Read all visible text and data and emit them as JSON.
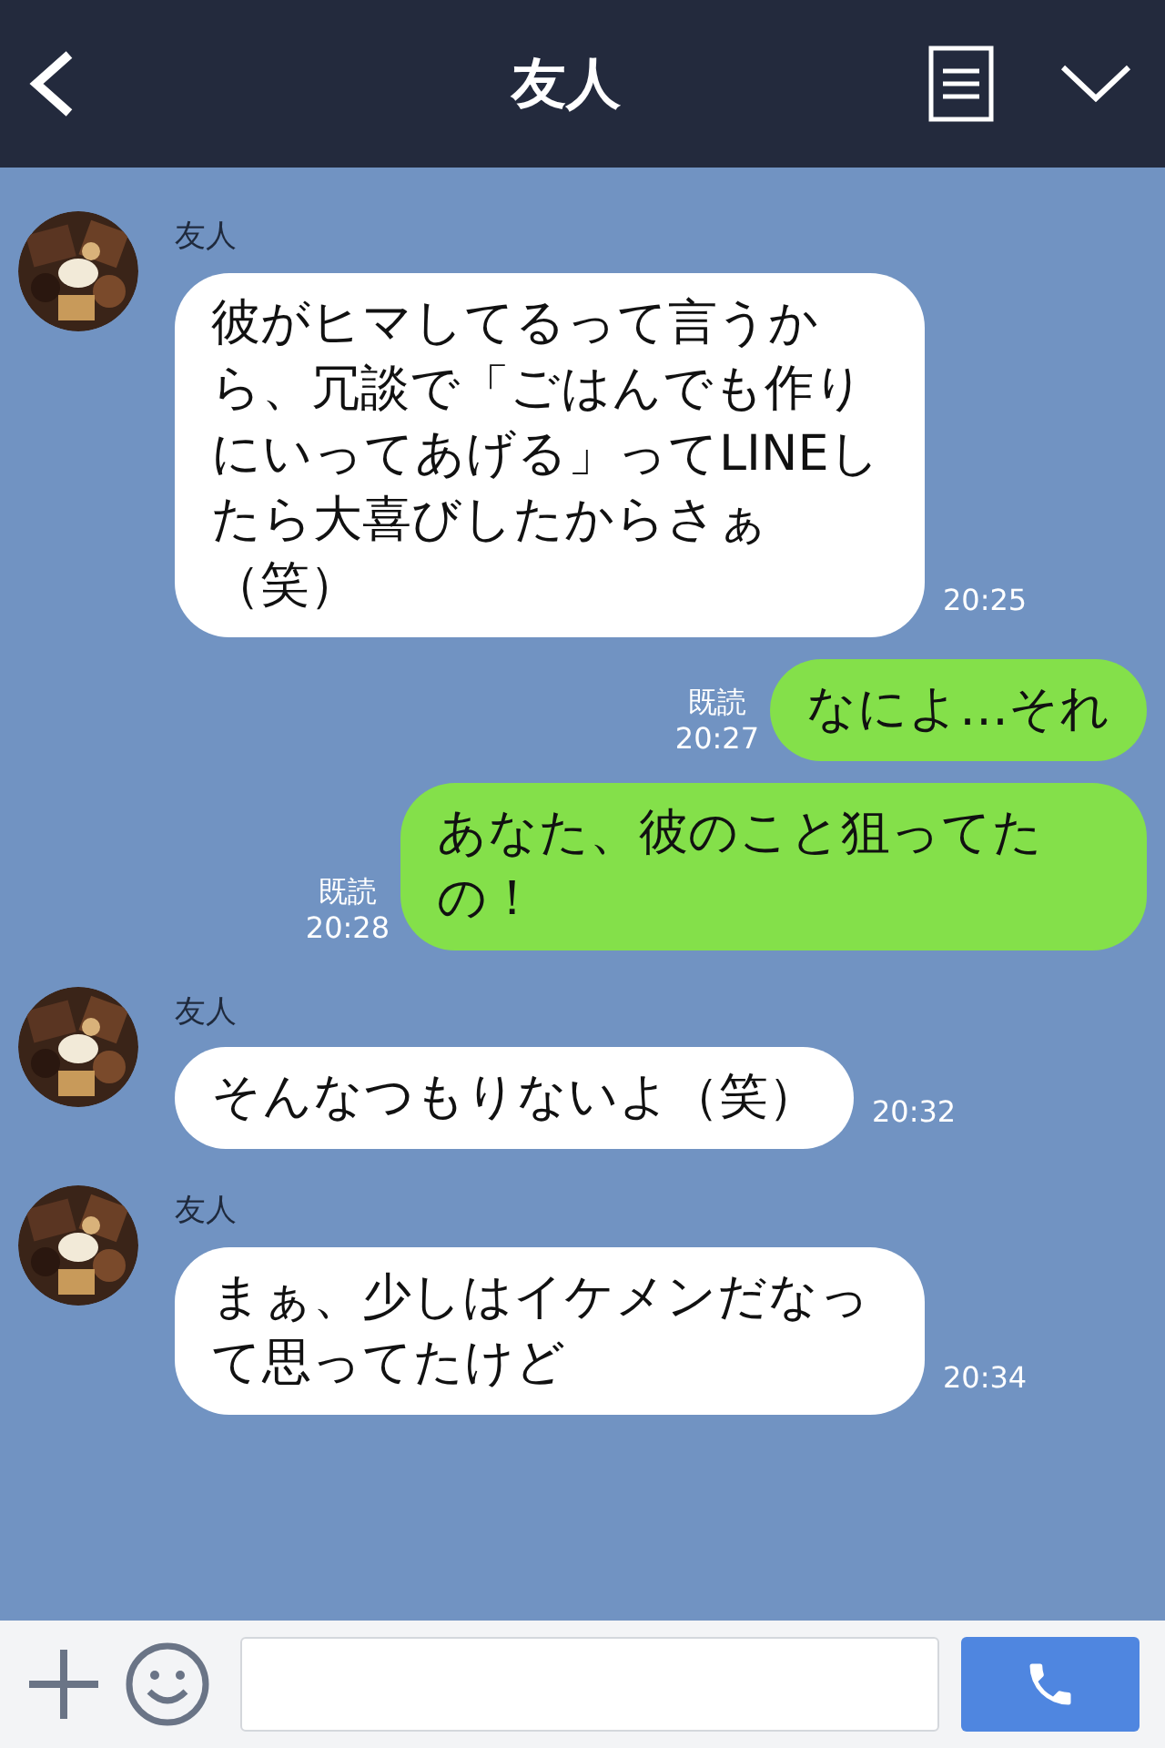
{
  "header": {
    "title": "友人"
  },
  "messages": [
    {
      "kind": "incoming",
      "sender": "友人",
      "text": "彼がヒマしてるって言うから、冗談で「ごはんでも作りにいってあげる」ってLINEしたら大喜びしたからさぁ（笑）",
      "time": "20:25"
    },
    {
      "kind": "outgoing",
      "read": "既読",
      "time": "20:27",
      "text": "なによ…それ"
    },
    {
      "kind": "outgoing",
      "read": "既読",
      "time": "20:28",
      "text": "あなた、彼のこと狙ってたの！"
    },
    {
      "kind": "incoming",
      "sender": "友人",
      "text": "そんなつもりないよ（笑）",
      "time": "20:32"
    },
    {
      "kind": "incoming",
      "sender": "友人",
      "text": "まぁ、少しはイケメンだなって思ってたけど",
      "time": "20:34"
    }
  ]
}
